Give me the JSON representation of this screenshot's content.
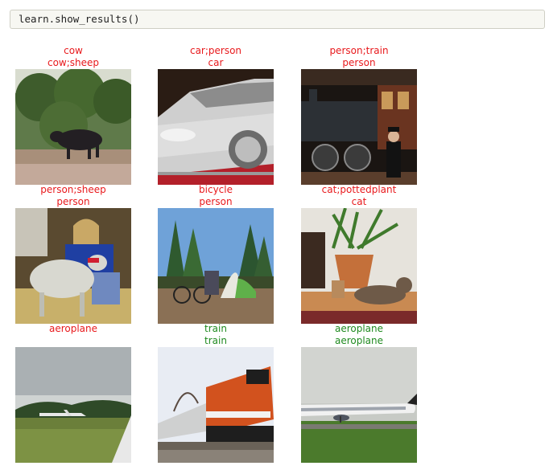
{
  "code": "learn.show_results()",
  "colors": {
    "wrong": "#e8191c",
    "right": "#1f8a1f"
  },
  "results": [
    {
      "target": "cow",
      "pred": "cow;sheep",
      "correct": false,
      "scene": "cow"
    },
    {
      "target": "car;person",
      "pred": "car",
      "correct": false,
      "scene": "car"
    },
    {
      "target": "person;train",
      "pred": "person",
      "correct": false,
      "scene": "locomotive"
    },
    {
      "target": "person;sheep",
      "pred": "person",
      "correct": false,
      "scene": "sheep-woman"
    },
    {
      "target": "bicycle",
      "pred": "person",
      "correct": false,
      "scene": "camping"
    },
    {
      "target": "cat;pottedplant",
      "pred": "cat",
      "correct": false,
      "scene": "cat-plant"
    },
    {
      "target": "aeroplane",
      "pred": "",
      "correct": false,
      "scene": "airfield"
    },
    {
      "target": "train",
      "pred": "train",
      "correct": true,
      "scene": "freight-train"
    },
    {
      "target": "aeroplane",
      "pred": "aeroplane",
      "correct": true,
      "scene": "airliner"
    }
  ]
}
